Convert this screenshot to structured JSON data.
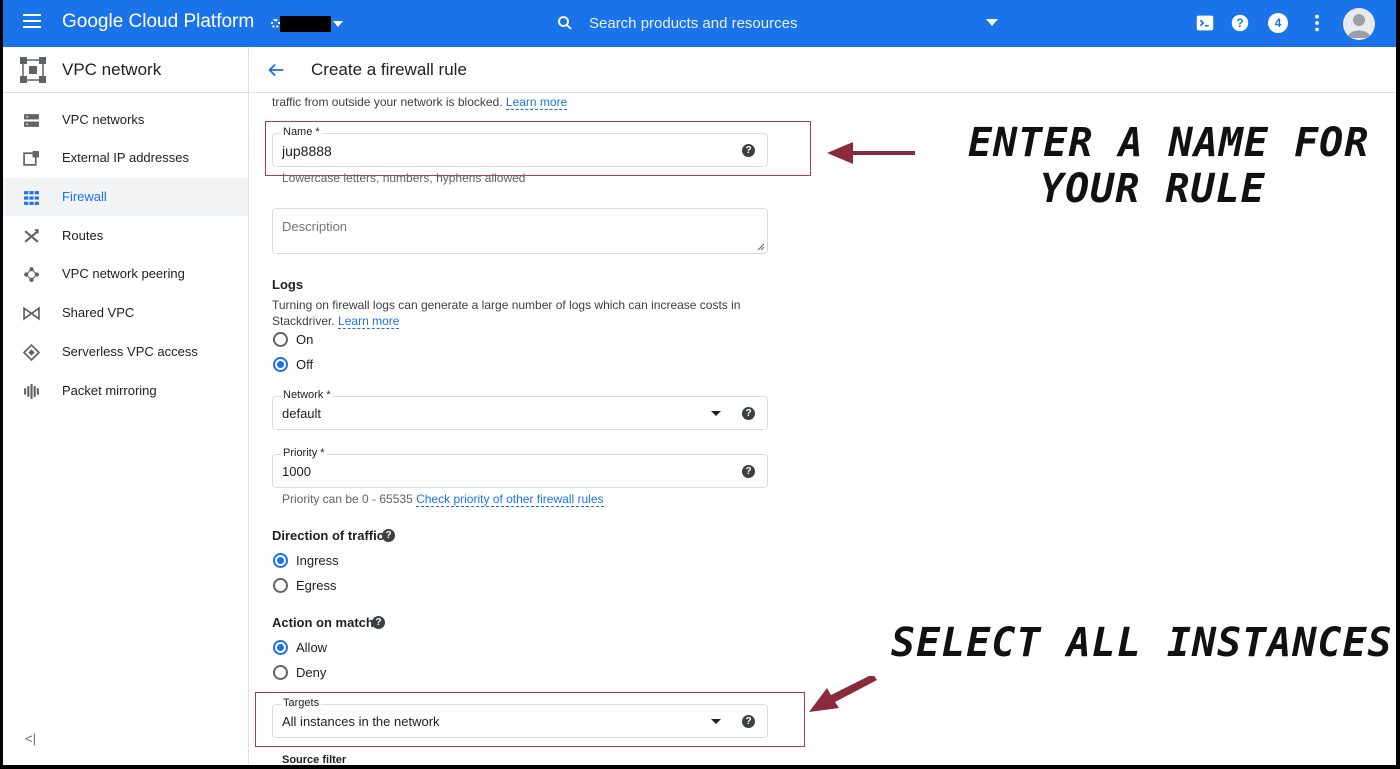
{
  "topbar": {
    "brand": "Google Cloud Platform",
    "search_placeholder": "Search products and resources",
    "notification_count": "4"
  },
  "subheader": {
    "product": "VPC network",
    "page_title": "Create a firewall rule"
  },
  "sidebar": {
    "items": [
      {
        "label": "VPC networks",
        "icon": "network-icon"
      },
      {
        "label": "External IP addresses",
        "icon": "ip-address-icon"
      },
      {
        "label": "Firewall",
        "icon": "firewall-icon",
        "active": true
      },
      {
        "label": "Routes",
        "icon": "routes-icon"
      },
      {
        "label": "VPC network peering",
        "icon": "peering-icon"
      },
      {
        "label": "Shared VPC",
        "icon": "shared-vpc-icon"
      },
      {
        "label": "Serverless VPC access",
        "icon": "serverless-icon"
      },
      {
        "label": "Packet mirroring",
        "icon": "mirroring-icon"
      }
    ],
    "collapse_label": "<|"
  },
  "form": {
    "intro_text": "traffic from outside your network is blocked.",
    "intro_link": "Learn more",
    "name": {
      "label": "Name *",
      "value": "jup8888",
      "hint": "Lowercase letters, numbers, hyphens allowed"
    },
    "description": {
      "placeholder": "Description"
    },
    "logs": {
      "title": "Logs",
      "text_line1": "Turning on firewall logs can generate a large number of logs which can increase costs in",
      "text_line2": "Stackdriver.",
      "link": "Learn more",
      "options": [
        "On",
        "Off"
      ],
      "selected": "Off"
    },
    "network": {
      "label": "Network *",
      "value": "default"
    },
    "priority": {
      "label": "Priority *",
      "value": "1000",
      "hint": "Priority can be 0 - 65535",
      "hint_link": "Check priority of other firewall rules"
    },
    "direction": {
      "title": "Direction of traffic",
      "options": [
        "Ingress",
        "Egress"
      ],
      "selected": "Ingress"
    },
    "action": {
      "title": "Action on match",
      "options": [
        "Allow",
        "Deny"
      ],
      "selected": "Allow"
    },
    "targets": {
      "label": "Targets",
      "value": "All instances in the network"
    },
    "source_filter": {
      "label": "Source filter"
    }
  },
  "annotations": {
    "name_line1": "ENTER A NAME FOR",
    "name_line2": "YOUR RULE",
    "targets": "SELECT ALL INSTANCES",
    "color": "#8b2a3a"
  }
}
